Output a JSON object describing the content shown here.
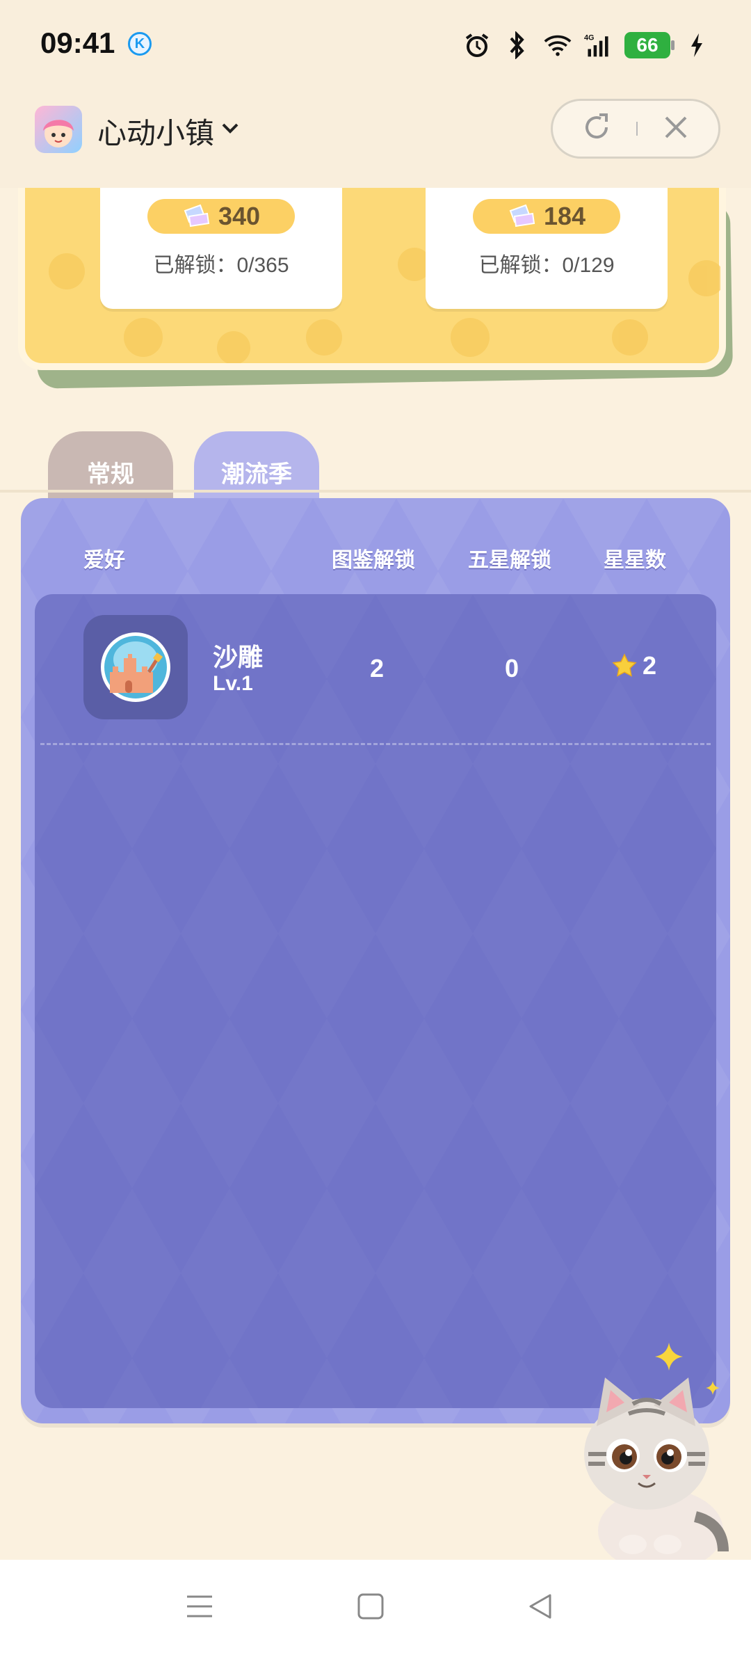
{
  "status_bar": {
    "time": "09:41",
    "k_badge": "K",
    "battery": "66",
    "icons": [
      "alarm-icon",
      "bluetooth-icon",
      "wifi-icon",
      "signal-4g-icon",
      "charging-icon"
    ]
  },
  "title_bar": {
    "app_name": "心动小镇",
    "icons": [
      "dropdown-chevron-icon",
      "refresh-icon",
      "close-icon"
    ]
  },
  "summary_cards": [
    {
      "value": "340",
      "unlock_label": "已解锁：0/365"
    },
    {
      "value": "184",
      "unlock_label": "已解锁：0/129"
    }
  ],
  "tabs": [
    {
      "label": "常规"
    },
    {
      "label": "潮流季"
    }
  ],
  "table": {
    "headers": {
      "hobby": "爱好",
      "dex_unlock": "图鉴解锁",
      "five_star_unlock": "五星解锁",
      "stars": "星星数"
    },
    "rows": [
      {
        "name": "沙雕",
        "level": "Lv.1",
        "dex_unlock": "2",
        "five_star_unlock": "0",
        "stars": "2",
        "icon": "sandcastle-icon"
      }
    ]
  },
  "colors": {
    "background": "#fbf1df",
    "panel": "#9a9de6",
    "panel_inner": "#7174c8",
    "yellow_card": "#fcd978",
    "tab_regular": "#c9b8b3",
    "tab_season": "#b5b5ec"
  }
}
